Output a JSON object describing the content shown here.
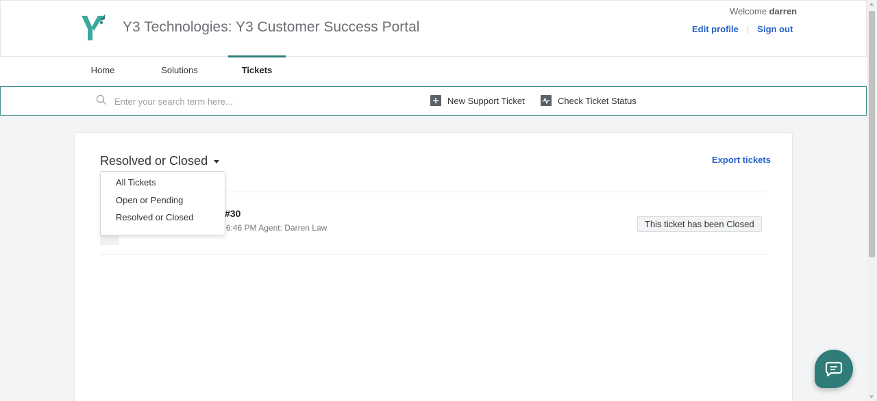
{
  "header": {
    "portal_title": "Y3 Technologies: Y3 Customer Success Portal",
    "welcome_prefix": "Welcome",
    "username": "darren",
    "edit_profile": "Edit profile",
    "separator": "|",
    "sign_out": "Sign out",
    "logo_icon": "y3-logo-icon",
    "brand_color": "#2e7f7a"
  },
  "tabs": [
    {
      "label": "Home",
      "active": false
    },
    {
      "label": "Solutions",
      "active": false
    },
    {
      "label": "Tickets",
      "active": true
    }
  ],
  "search": {
    "placeholder": "Enter your search term here...",
    "value": "",
    "icon": "search-icon"
  },
  "actions": {
    "new_ticket": "New Support Ticket",
    "new_ticket_icon": "plus-square-icon",
    "check_status": "Check Ticket Status",
    "check_status_icon": "activity-icon"
  },
  "tickets_view": {
    "filter_label": "Resolved or Closed",
    "export_label": "Export tickets",
    "filter_options": [
      "All Tickets",
      "Open or Pending",
      "Resolved or Closed"
    ]
  },
  "tickets": [
    {
      "title_visible": "#30",
      "meta_visible": "Created on Wed, 2 Sep at 6:46 PM Agent: Darren Law",
      "status": "This ticket has been Closed"
    }
  ],
  "chat": {
    "icon": "chat-bubble-icon",
    "color": "#2f7c78"
  }
}
